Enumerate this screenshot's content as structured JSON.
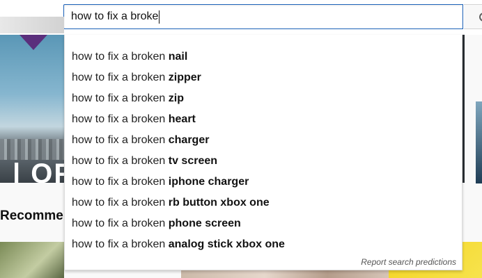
{
  "search": {
    "query": "how to fix a broke",
    "icon": "search-icon"
  },
  "suggestions": {
    "prefix": "how to fix a broken ",
    "items": [
      "nail",
      "zipper",
      "zip",
      "heart",
      "charger",
      "tv screen",
      "iphone charger",
      "rb button xbox one",
      "phone screen",
      "analog stick xbox one"
    ],
    "report_label": "Report search predictions"
  },
  "background": {
    "thumbnail_overlay_text": "| OFF",
    "section_heading": "Recommen"
  },
  "colors": {
    "focus_border": "#1c62b9",
    "text": "#222222",
    "yellow_thumb": "#f4d422"
  }
}
